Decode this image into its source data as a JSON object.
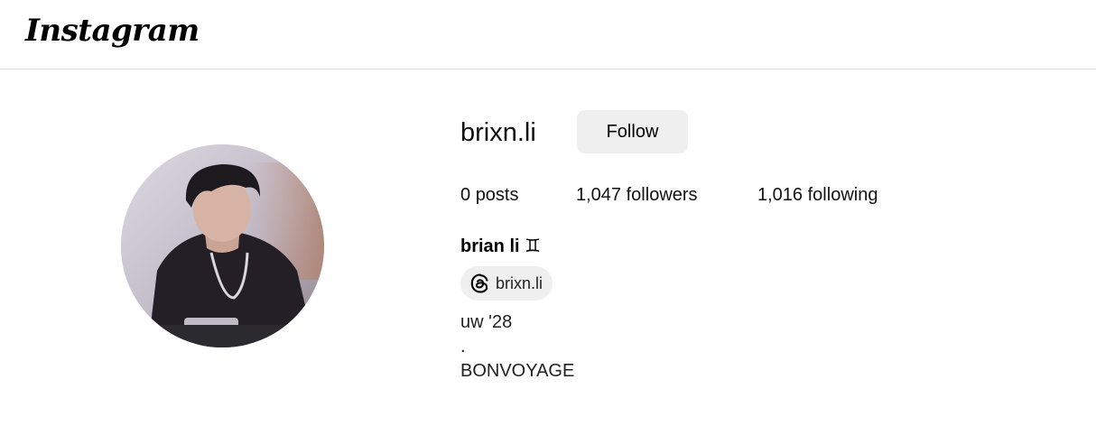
{
  "header": {
    "logo_text": "Instagram"
  },
  "profile": {
    "username": "brixn.li",
    "follow_label": "Follow",
    "stats": {
      "posts_count": "0",
      "posts_label": "posts",
      "followers_count": "1,047",
      "followers_label": "followers",
      "following_count": "1,016",
      "following_label": "following"
    },
    "full_name": "brian li ♊︎",
    "threads_handle": "brixn.li",
    "bio": [
      "uw '28",
      ".",
      "BONVOYAGE"
    ]
  },
  "icons": {
    "threads": "threads-icon"
  },
  "colors": {
    "button_bg": "#efefef",
    "divider": "#dbdbdb",
    "text": "#111111"
  }
}
